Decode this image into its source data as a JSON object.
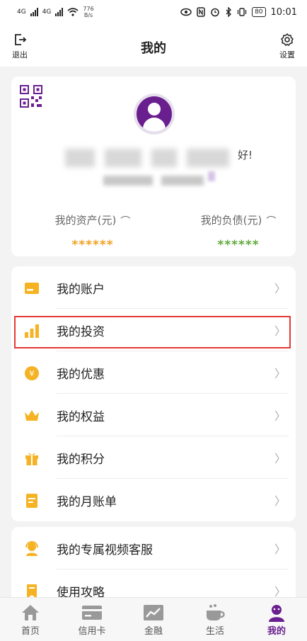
{
  "status_bar": {
    "network_left": "4G",
    "network_right": "4G",
    "speed_value": "776",
    "speed_unit": "B/s",
    "battery": "80",
    "time": "10:01"
  },
  "header": {
    "logout_label": "退出",
    "title": "我的",
    "settings_label": "设置"
  },
  "profile": {
    "name_tail": "好!",
    "assets_label": "我的资产(元)",
    "assets_value": "******",
    "assets_color": "#f0a020",
    "debt_label": "我的负债(元)",
    "debt_value": "******",
    "debt_color": "#5fa83a"
  },
  "menu": {
    "items": [
      {
        "label": "我的账户",
        "icon": "card-icon"
      },
      {
        "label": "我的投资",
        "icon": "bar-chart-icon"
      },
      {
        "label": "我的优惠",
        "icon": "yuan-coin-icon"
      },
      {
        "label": "我的权益",
        "icon": "crown-icon"
      },
      {
        "label": "我的积分",
        "icon": "gift-icon"
      },
      {
        "label": "我的月账单",
        "icon": "bill-icon"
      }
    ],
    "items2": [
      {
        "label": "我的专属视频客服",
        "icon": "customer-service-icon"
      },
      {
        "label": "使用攻略",
        "icon": "bookmark-icon"
      }
    ]
  },
  "tabbar": {
    "items": [
      {
        "label": "首页",
        "icon": "home-icon"
      },
      {
        "label": "信用卡",
        "icon": "credit-card-icon"
      },
      {
        "label": "金融",
        "icon": "trend-chart-icon"
      },
      {
        "label": "生活",
        "icon": "coffee-cup-icon"
      },
      {
        "label": "我的",
        "icon": "user-icon"
      }
    ],
    "active_color": "#6a1f8f"
  },
  "colors": {
    "accent_yellow": "#f5b324",
    "brand_purple": "#6a1f8f",
    "highlight_red": "#e53935"
  }
}
